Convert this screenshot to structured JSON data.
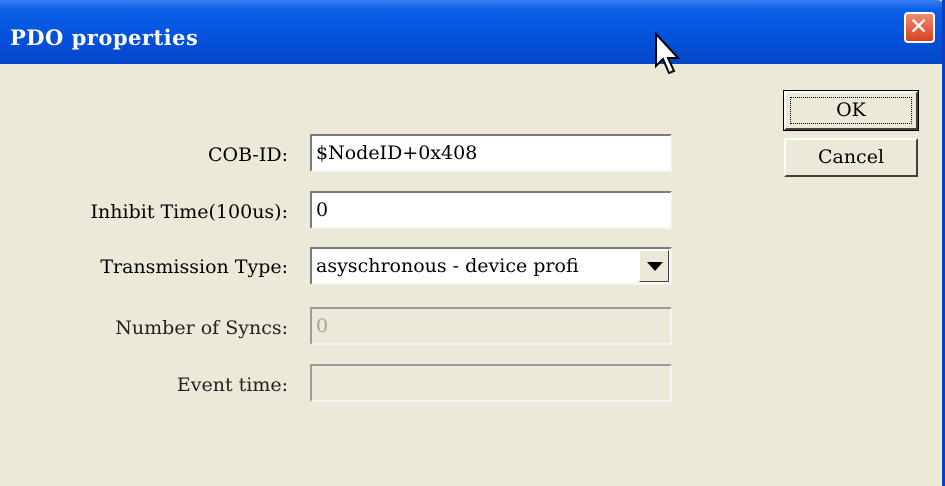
{
  "dialog": {
    "title": "PDO properties"
  },
  "fields": {
    "cob_id": {
      "label": "COB-ID:",
      "value": "$NodeID+0x408"
    },
    "inhibit_time": {
      "label": "Inhibit Time(100us):",
      "value": "0"
    },
    "transmission_type": {
      "label": "Transmission Type:",
      "value": "asyschronous - device profi"
    },
    "number_of_syncs": {
      "label": "Number of Syncs:",
      "value": "0"
    },
    "event_time": {
      "label": "Event time:",
      "value": ""
    }
  },
  "buttons": {
    "ok": "OK",
    "cancel": "Cancel"
  }
}
